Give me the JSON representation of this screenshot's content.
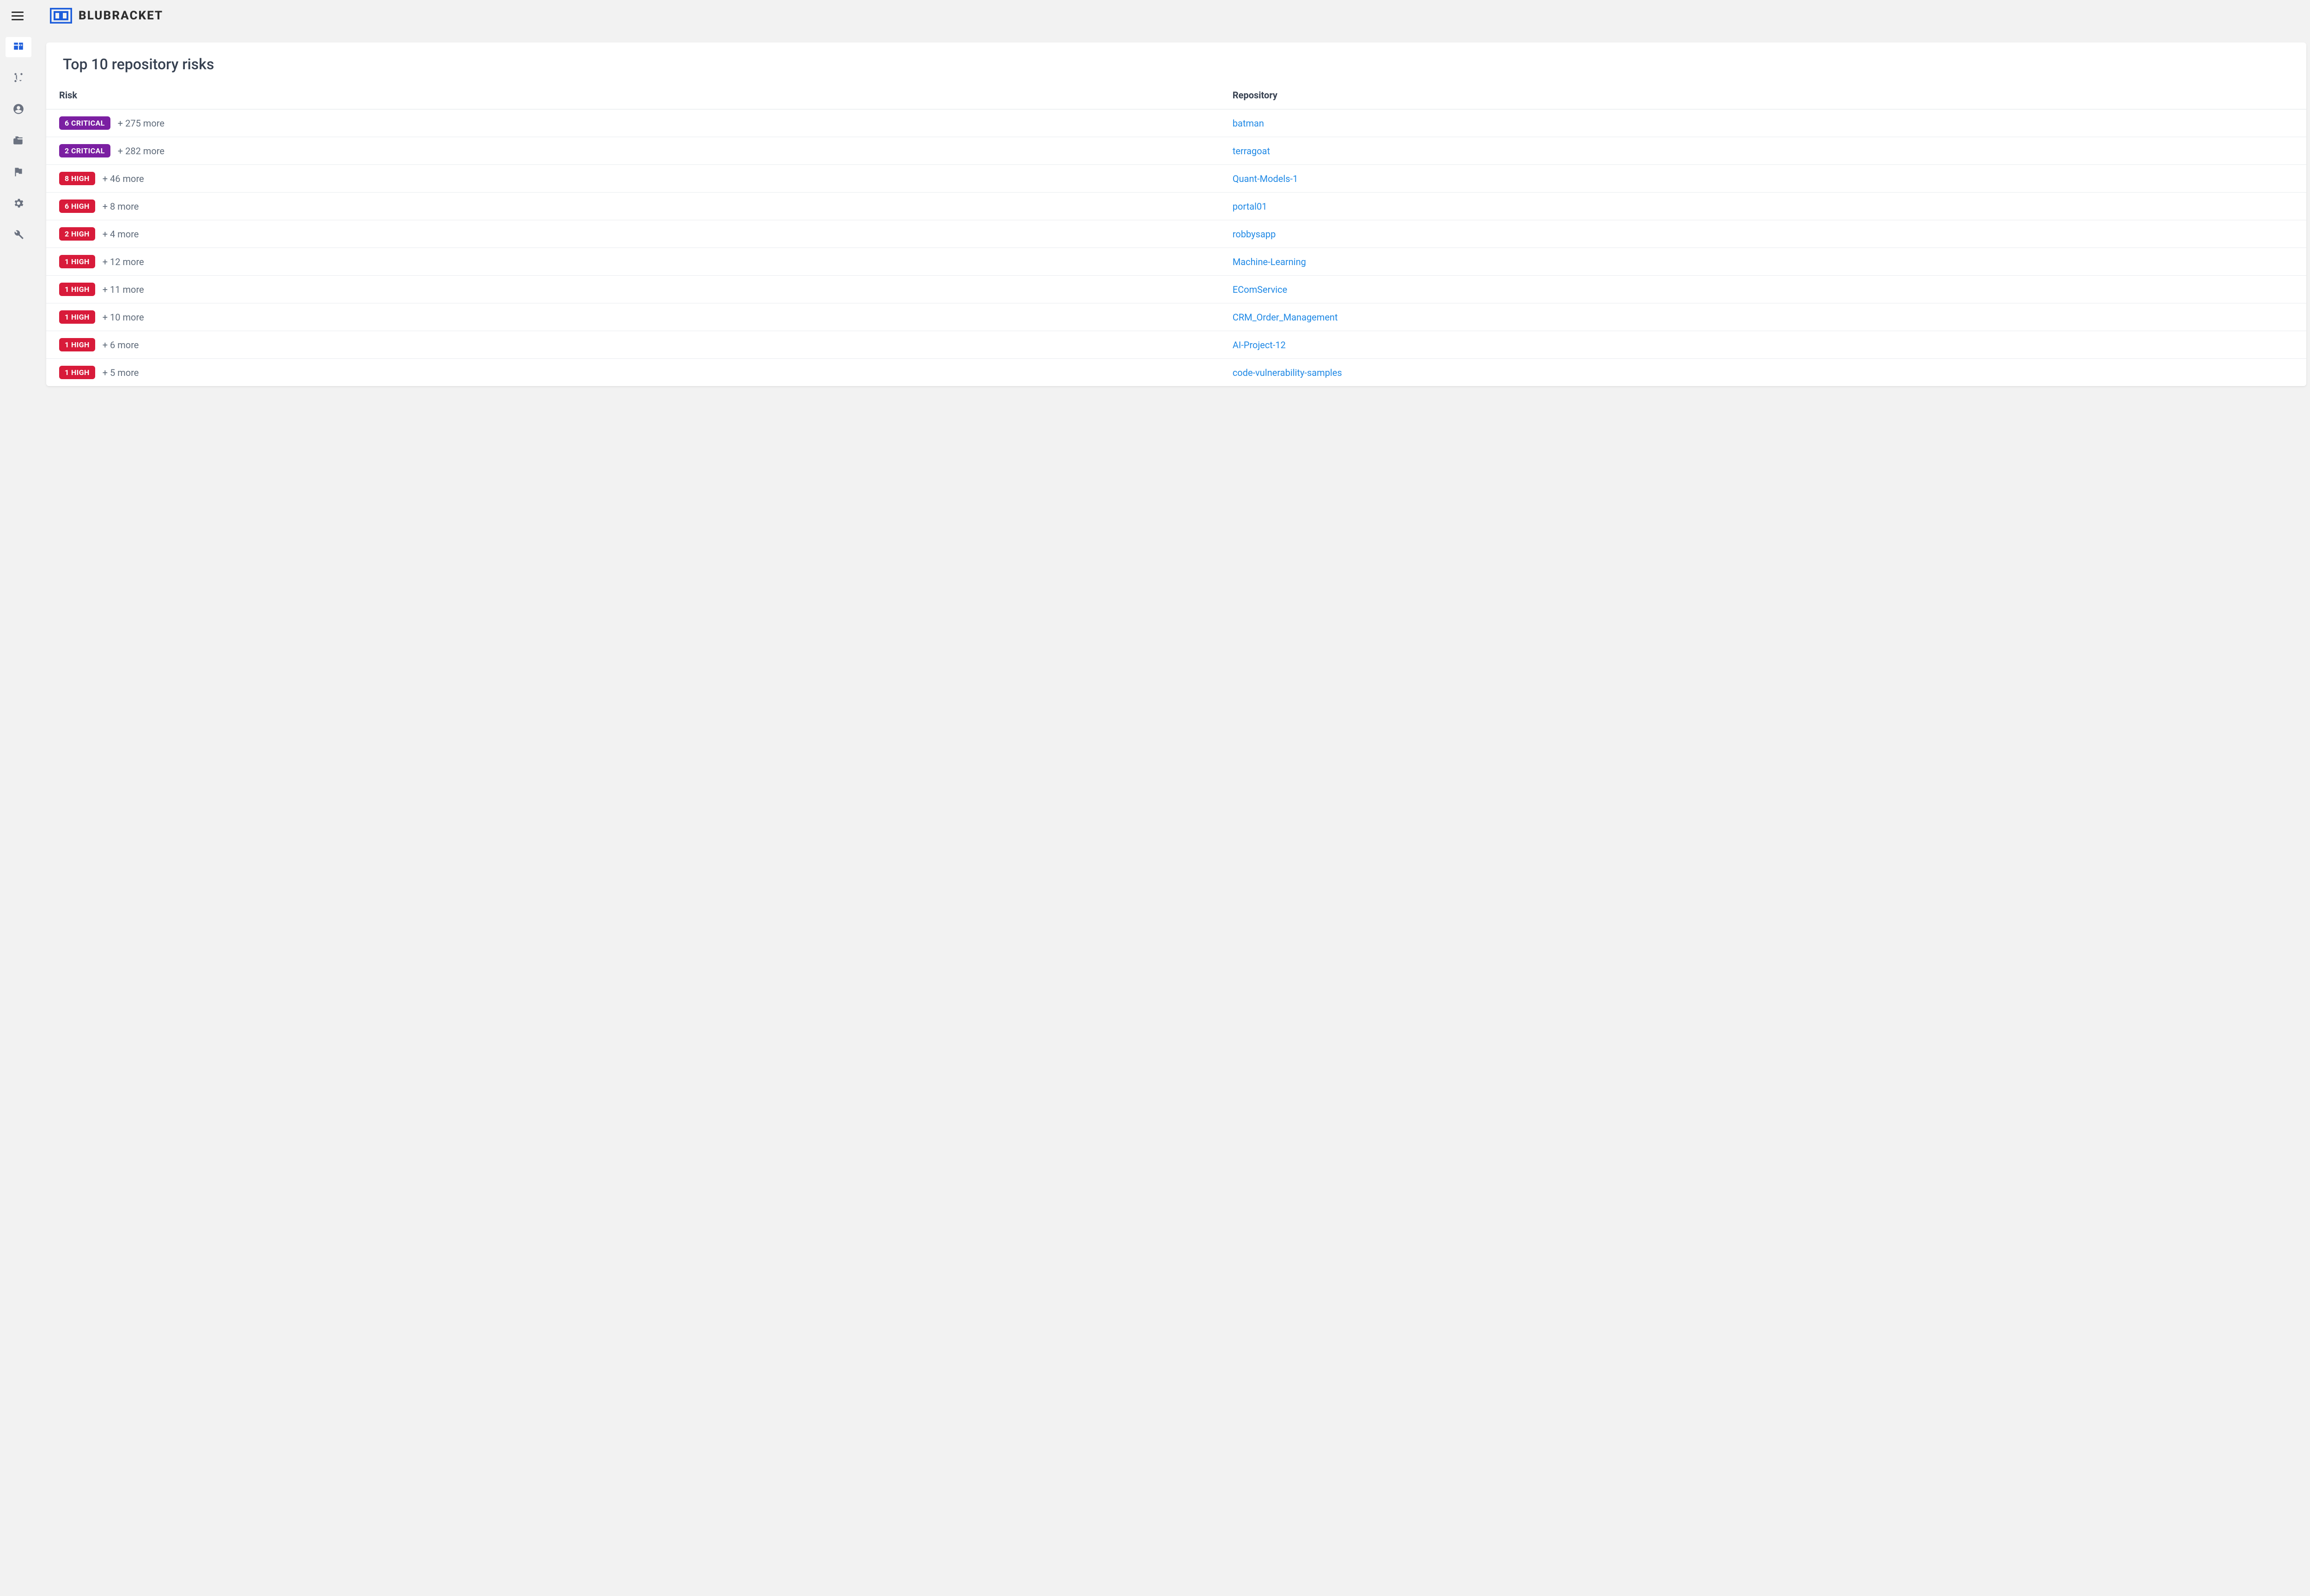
{
  "brand": {
    "name": "BLUBRACKET"
  },
  "sidebar": {
    "items": [
      {
        "name": "dashboard",
        "active": true
      },
      {
        "name": "branches",
        "active": false
      },
      {
        "name": "users",
        "active": false
      },
      {
        "name": "repositories",
        "active": false
      },
      {
        "name": "alerts",
        "active": false
      },
      {
        "name": "settings",
        "active": false
      },
      {
        "name": "tools",
        "active": false
      }
    ]
  },
  "card": {
    "title": "Top 10 repository risks",
    "columns": {
      "risk": "Risk",
      "repository": "Repository"
    },
    "rows": [
      {
        "badge_count": "6",
        "badge_level": "CRITICAL",
        "badge_class": "critical",
        "more": "+ 275 more",
        "repo": "batman"
      },
      {
        "badge_count": "2",
        "badge_level": "CRITICAL",
        "badge_class": "critical",
        "more": "+ 282 more",
        "repo": "terragoat"
      },
      {
        "badge_count": "8",
        "badge_level": "HIGH",
        "badge_class": "high",
        "more": "+ 46 more",
        "repo": "Quant-Models-1"
      },
      {
        "badge_count": "6",
        "badge_level": "HIGH",
        "badge_class": "high",
        "more": "+ 8 more",
        "repo": "portal01"
      },
      {
        "badge_count": "2",
        "badge_level": "HIGH",
        "badge_class": "high",
        "more": "+ 4 more",
        "repo": "robbysapp"
      },
      {
        "badge_count": "1",
        "badge_level": "HIGH",
        "badge_class": "high",
        "more": "+ 12 more",
        "repo": "Machine-Learning"
      },
      {
        "badge_count": "1",
        "badge_level": "HIGH",
        "badge_class": "high",
        "more": "+ 11 more",
        "repo": "EComService"
      },
      {
        "badge_count": "1",
        "badge_level": "HIGH",
        "badge_class": "high",
        "more": "+ 10 more",
        "repo": "CRM_Order_Management"
      },
      {
        "badge_count": "1",
        "badge_level": "HIGH",
        "badge_class": "high",
        "more": "+ 6 more",
        "repo": "AI-Project-12"
      },
      {
        "badge_count": "1",
        "badge_level": "HIGH",
        "badge_class": "high",
        "more": "+ 5 more",
        "repo": "code-vulnerability-samples"
      }
    ]
  }
}
